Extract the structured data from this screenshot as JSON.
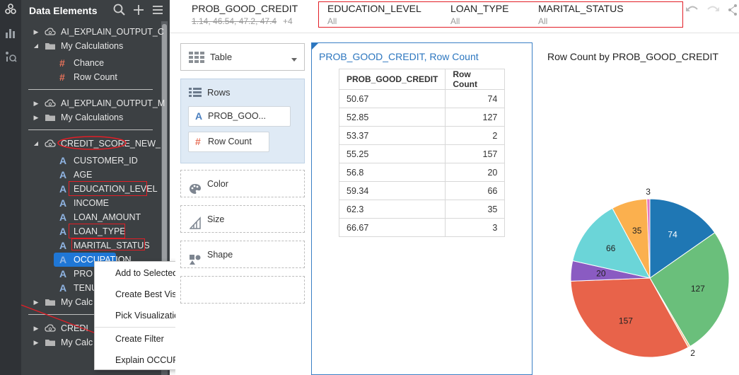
{
  "panel": {
    "title": "Data Elements",
    "tree": [
      {
        "label": "AI_EXPLAIN_OUTPUT_C",
        "kind": "dataset",
        "caret": "right"
      },
      {
        "label": "My Calculations",
        "kind": "folder",
        "caret": "down"
      },
      {
        "label": "Chance",
        "kind": "measure"
      },
      {
        "label": "Row Count",
        "kind": "measure"
      },
      {
        "label": "AI_EXPLAIN_OUTPUT_M",
        "kind": "dataset",
        "caret": "right"
      },
      {
        "label": "My Calculations",
        "kind": "folder",
        "caret": "right"
      },
      {
        "label": "CREDIT_SCORE_NEW_",
        "kind": "dataset",
        "caret": "down"
      },
      {
        "label": "CUSTOMER_ID",
        "kind": "attribute"
      },
      {
        "label": "AGE",
        "kind": "attribute"
      },
      {
        "label": "EDUCATION_LEVEL",
        "kind": "attribute"
      },
      {
        "label": "INCOME",
        "kind": "attribute"
      },
      {
        "label": "LOAN_AMOUNT",
        "kind": "attribute"
      },
      {
        "label": "LOAN_TYPE",
        "kind": "attribute"
      },
      {
        "label": "MARITAL_STATUS",
        "kind": "attribute"
      },
      {
        "label": "OCCUPATION",
        "kind": "attribute",
        "selected": true
      },
      {
        "label": "PRO",
        "kind": "attribute"
      },
      {
        "label": "TENU",
        "kind": "attribute"
      },
      {
        "label": "My Calc",
        "kind": "folder",
        "caret": "right"
      },
      {
        "label": "CREDI",
        "kind": "dataset",
        "caret": "right"
      },
      {
        "label": "My Calc",
        "kind": "folder",
        "caret": "right"
      }
    ]
  },
  "context_menu": {
    "items": [
      "Add to Selected Visualization",
      "Create Best Visualization",
      "Pick Visualization...",
      "Create Filter",
      "Explain OCCUPATION"
    ]
  },
  "filters": {
    "prob": {
      "name": "PROB_GOOD_CREDIT",
      "value": "1.14, 46.54, 47.2, 47.4",
      "more": "+4"
    },
    "items": [
      {
        "name": "EDUCATION_LEVEL",
        "value": "All"
      },
      {
        "name": "LOAN_TYPE",
        "value": "All"
      },
      {
        "name": "MARITAL_STATUS",
        "value": "All"
      }
    ]
  },
  "grammar": {
    "viz_type": "Table",
    "rows_label": "Rows",
    "row_pills": [
      "PROB_GOO...",
      "Row Count"
    ],
    "drops": [
      "Color",
      "Size",
      "Shape"
    ]
  },
  "table_viz": {
    "title": "PROB_GOOD_CREDIT, Row Count",
    "columns": [
      "PROB_GOOD_CREDIT",
      "Row Count"
    ],
    "rows": [
      [
        "50.67",
        "74"
      ],
      [
        "52.85",
        "127"
      ],
      [
        "53.37",
        "2"
      ],
      [
        "55.25",
        "157"
      ],
      [
        "56.8",
        "20"
      ],
      [
        "59.34",
        "66"
      ],
      [
        "62.3",
        "35"
      ],
      [
        "66.67",
        "3"
      ]
    ]
  },
  "pie": {
    "title": "Row Count by PROB_GOOD_CREDIT",
    "slices": [
      {
        "value": 74,
        "color": "#1f77b4"
      },
      {
        "value": 127,
        "color": "#6abf7b"
      },
      {
        "value": 2,
        "color": "#f2c38c"
      },
      {
        "value": 157,
        "color": "#e8634a"
      },
      {
        "value": 20,
        "color": "#8a5bc2"
      },
      {
        "value": 66,
        "color": "#6bd5d8"
      },
      {
        "value": 35,
        "color": "#fbb04e"
      },
      {
        "value": 3,
        "color": "#e377c2"
      }
    ]
  },
  "colors": {
    "accent": "#1f77d6",
    "annotation": "#e21e26",
    "panel_bg": "#3c4043"
  }
}
